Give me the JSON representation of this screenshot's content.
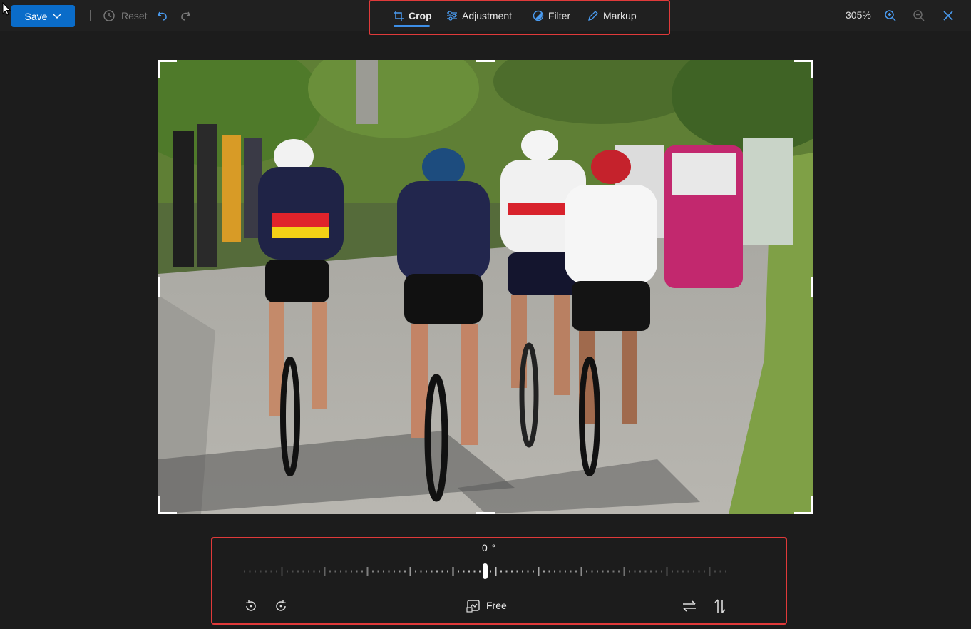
{
  "toolbar": {
    "save_label": "Save",
    "reset_label": "Reset",
    "zoom_level": "305%"
  },
  "tabs": [
    {
      "label": "Crop",
      "icon": "crop-icon",
      "active": true
    },
    {
      "label": "Adjustment",
      "icon": "adjustment-sliders-icon",
      "active": false
    },
    {
      "label": "Filter",
      "icon": "filter-icon",
      "active": false
    },
    {
      "label": "Markup",
      "icon": "pen-icon",
      "active": false
    }
  ],
  "crop_panel": {
    "angle_readout": "0 °",
    "rotation_value_degrees": 0,
    "aspect_label": "Free"
  },
  "colors": {
    "accent": "#0a6cc9",
    "tab_underline": "#3d8ee6",
    "highlight_border": "#e03a3a",
    "background": "#1c1c1c"
  }
}
